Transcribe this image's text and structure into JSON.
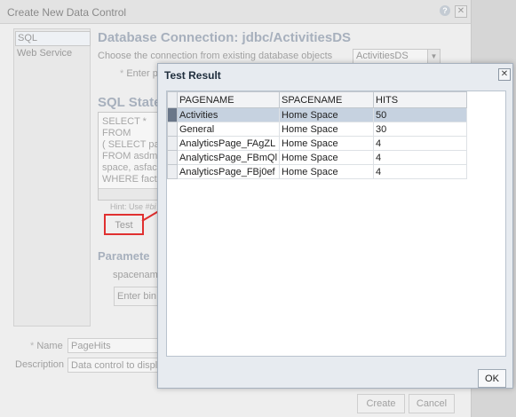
{
  "background_dialog": {
    "title": "Create New Data Control",
    "help_icon": "?",
    "close_icon": "✕",
    "nav": [
      {
        "label": "SQL",
        "selected": true
      },
      {
        "label": "Web Service",
        "selected": false
      }
    ],
    "db_connection_heading": "Database Connection: jdbc/ActivitiesDS",
    "choose_connection_text": "Choose the connection from existing database objects",
    "connection_select_value": "ActivitiesDS",
    "required_star": "*",
    "enter_partial": "Enter p",
    "sql_heading": "SQL Statem",
    "sql_lines": [
      "SELECT *",
      "FROM",
      "( SELECT pag",
      "FROM asdm",
      "space, asfac",
      "WHERE fact."
    ],
    "hint_text": "Hint: Use",
    "hint_italic": "#bi",
    "test_button": "Test",
    "parameters_heading": "Paramete",
    "param_label": "spacename",
    "enter_bind_button": "Enter bin",
    "name_label": "Name",
    "name_value": "PageHits",
    "description_label": "Description",
    "description_value": "Data control to displa",
    "create_button": "Create",
    "cancel_button": "Cancel"
  },
  "modal": {
    "title": "Test Result",
    "close_icon": "✕",
    "ok_button": "OK",
    "columns": [
      "PAGENAME",
      "SPACENAME",
      "HITS"
    ],
    "rows": [
      [
        "Activities",
        "Home Space",
        "50"
      ],
      [
        "General",
        "Home Space",
        "30"
      ],
      [
        "AnalyticsPage_FAgZL",
        "Home Space",
        "4"
      ],
      [
        "AnalyticsPage_FBmQl",
        "Home Space",
        "4"
      ],
      [
        "AnalyticsPage_FBj0ef",
        "Home Space",
        "4"
      ]
    ],
    "selected_row": 0
  },
  "colors": {
    "highlight_border": "#e03030",
    "selected_row": "#c6d2e0",
    "selected_row_header": "#6a7789"
  }
}
